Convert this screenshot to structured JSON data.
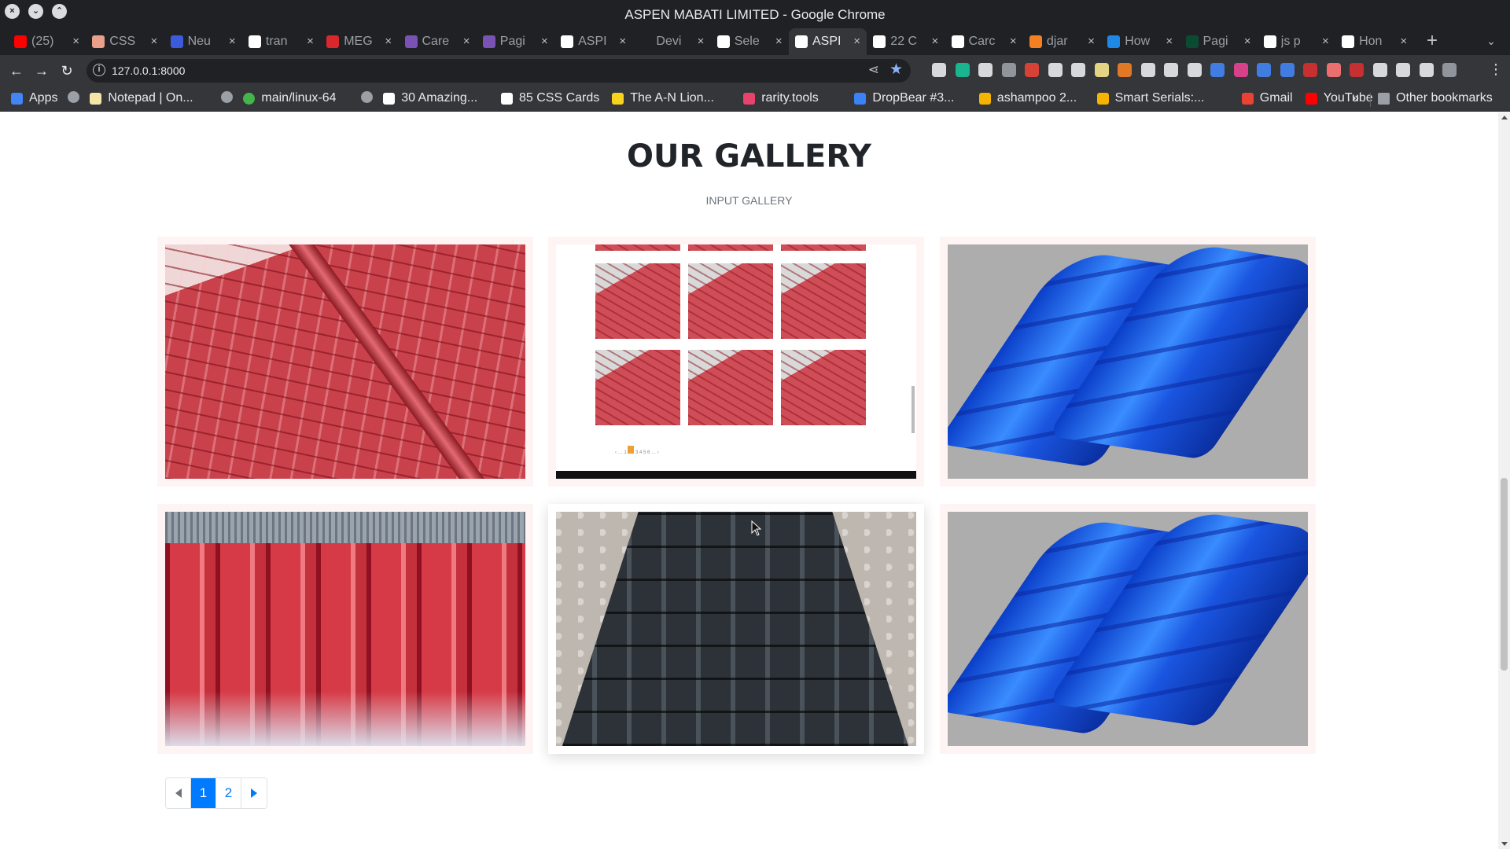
{
  "window": {
    "title": "ASPEN MABATI LIMITED - Google Chrome"
  },
  "tabs": [
    {
      "label": "(25)",
      "icon": "youtube-icon",
      "color": "#ff0000"
    },
    {
      "label": "CSS",
      "icon": "person-icon",
      "color": "#e8a08a"
    },
    {
      "label": "Neu",
      "icon": "square-icon",
      "color": "#3b5bdb"
    },
    {
      "label": "tran",
      "icon": "google-icon",
      "color": "#ffffff"
    },
    {
      "label": "MEG",
      "icon": "mega-icon",
      "color": "#d9272e"
    },
    {
      "label": "Care",
      "icon": "bootstrap-icon",
      "color": "#7952b3"
    },
    {
      "label": "Pagi",
      "icon": "bootstrap-icon",
      "color": "#7952b3"
    },
    {
      "label": "ASPI",
      "icon": "globe-icon",
      "color": "#ffffff"
    },
    {
      "label": "Devi",
      "icon": "dev-icon",
      "color": "#202124"
    },
    {
      "label": "Sele",
      "icon": "globe-icon",
      "color": "#ffffff"
    },
    {
      "label": "ASPI",
      "icon": "globe-icon",
      "color": "#ffffff",
      "active": true
    },
    {
      "label": "22 C",
      "icon": "f-icon",
      "color": "#ffffff"
    },
    {
      "label": "Carc",
      "icon": "codepen-icon",
      "color": "#ffffff"
    },
    {
      "label": "djar",
      "icon": "stackoverflow-icon",
      "color": "#f48024"
    },
    {
      "label": "How",
      "icon": "s-icon",
      "color": "#1e88e5"
    },
    {
      "label": "Pagi",
      "icon": "django-icon",
      "color": "#0c4b33"
    },
    {
      "label": "js p",
      "icon": "google-icon",
      "color": "#ffffff"
    },
    {
      "label": "Hon",
      "icon": "globe-icon",
      "color": "#ffffff"
    }
  ],
  "toolbar": {
    "url": "127.0.0.1:8000"
  },
  "bookmarks": [
    {
      "label": "Apps",
      "icon": "apps-grid-icon",
      "color": "#4285f4"
    },
    {
      "label": "",
      "icon": "globe-icon",
      "color": "#9aa0a6"
    },
    {
      "label": "Notepad | On...",
      "icon": "notepad-icon",
      "color": "#f5e6a8"
    },
    {
      "label": "",
      "icon": "globe-icon",
      "color": "#9aa0a6"
    },
    {
      "label": "main/linux-64",
      "icon": "circle-icon",
      "color": "#44b649"
    },
    {
      "label": "",
      "icon": "globe-icon",
      "color": "#9aa0a6"
    },
    {
      "label": "30 Amazing...",
      "icon": "codepen-icon",
      "color": "#ffffff"
    },
    {
      "label": "85 CSS Cards",
      "icon": "f-icon",
      "color": "#ffffff"
    },
    {
      "label": "The A-N Lion...",
      "icon": "lion-icon",
      "color": "#f7d21e"
    },
    {
      "label": "rarity.tools",
      "icon": "rt-icon",
      "color": "#e8436b"
    },
    {
      "label": "DropBear #3...",
      "icon": "dropbear-icon",
      "color": "#3b82f6"
    },
    {
      "label": "ashampoo 2...",
      "icon": "arrow-icon",
      "color": "#f4b400"
    },
    {
      "label": "Smart Serials:...",
      "icon": "arrow-icon",
      "color": "#f4b400"
    },
    {
      "label": "Gmail",
      "icon": "gmail-icon",
      "color": "#ea4335"
    },
    {
      "label": "YouTube",
      "icon": "youtube-icon",
      "color": "#ff0000"
    }
  ],
  "bookmarks_more": "»",
  "other_bookmarks": "Other bookmarks",
  "gallery": {
    "title": "OUR GALLERY",
    "subtitle": "INPUT GALLERY",
    "images": [
      {
        "name": "red-tile-roof-image"
      },
      {
        "name": "screenshot-gallery-image"
      },
      {
        "name": "blue-roof-sheet-image"
      },
      {
        "name": "red-corrugated-sheet-image"
      },
      {
        "name": "black-roof-sheet-image"
      },
      {
        "name": "blue-roof-sheet-image"
      }
    ]
  },
  "pagination": {
    "pages": [
      "1",
      "2"
    ],
    "current": "1"
  },
  "colors": {
    "accent": "#007bff",
    "card_bg": "#fff4f4",
    "title": "#212529"
  }
}
